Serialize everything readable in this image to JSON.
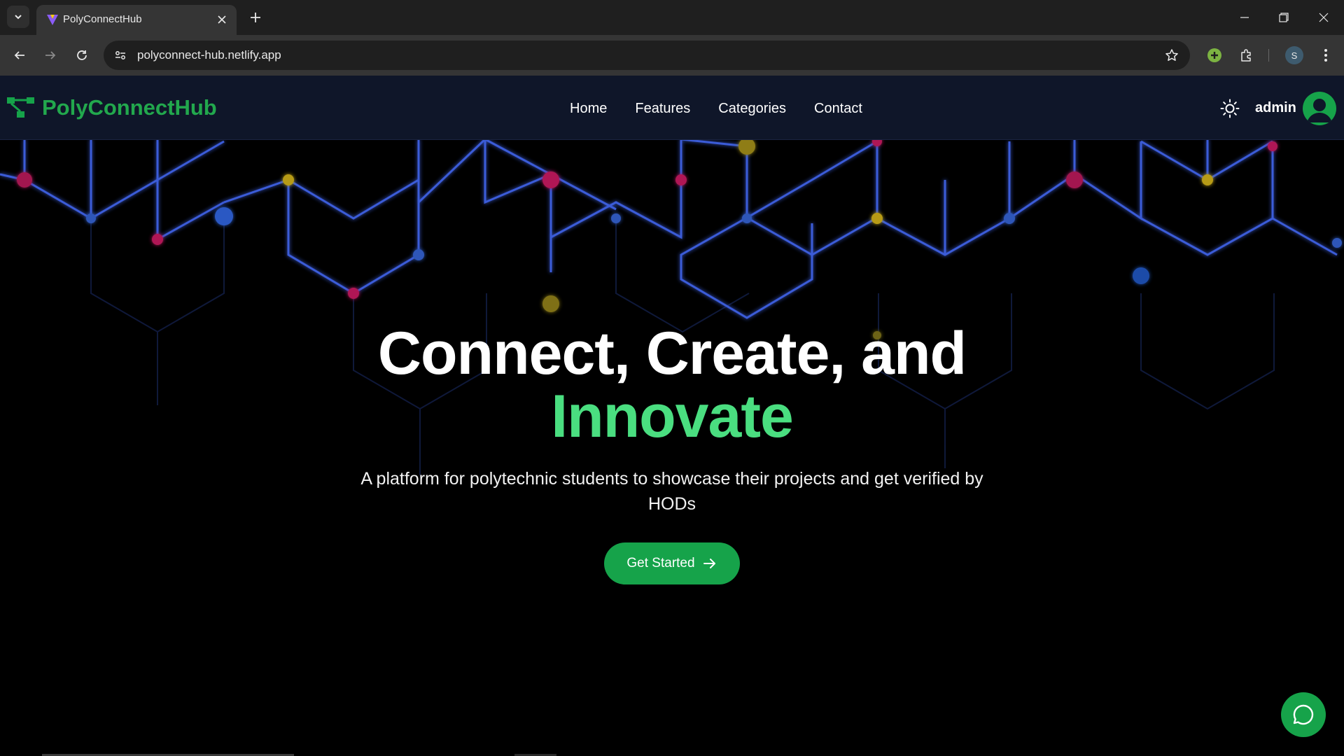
{
  "browser": {
    "tab_title": "PolyConnectHub",
    "url": "polyconnect-hub.netlify.app",
    "profile_initial": "S"
  },
  "site": {
    "brand": "PolyConnectHub",
    "nav": [
      "Home",
      "Features",
      "Categories",
      "Contact"
    ],
    "username": "admin",
    "colors": {
      "brand_green": "#22a84d",
      "accent_green": "#4ade80",
      "nav_bg": "#0f1629"
    }
  },
  "hero": {
    "title_line1": "Connect, Create, and",
    "title_line2": "Innovate",
    "subtitle": "A platform for polytechnic students to showcase their projects and get verified by HODs",
    "cta_label": "Get Started"
  },
  "icons": {
    "logo": "network-icon",
    "theme": "sun-icon",
    "avatar": "user-icon",
    "cta": "arrow-right-icon",
    "chat": "chat-bubble-icon"
  }
}
